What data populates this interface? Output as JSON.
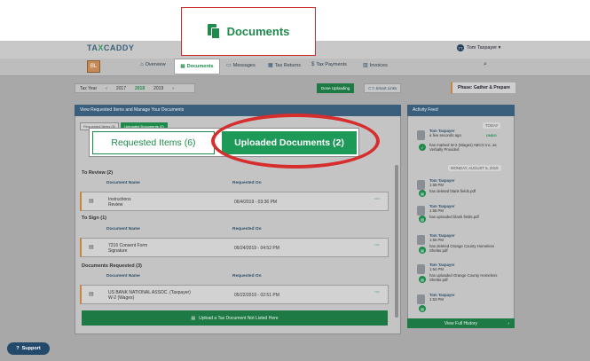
{
  "app": {
    "logo_main": "TA",
    "logo_accent": "X",
    "logo_rest": "CADDY",
    "user_initials": "TT",
    "user_name": "Tom Taxpayer ▾",
    "brand_initials": "BL"
  },
  "nav": {
    "overview": "Overview",
    "documents": "Documents",
    "messages": "Messages",
    "tax_returns": "Tax Returns",
    "tax_payments": "Tax Payments",
    "invoices": "Invoices"
  },
  "callout": {
    "documents": "Documents"
  },
  "tax_year": {
    "label": "Tax Year",
    "years": [
      "2017",
      "2018",
      "2019"
    ],
    "selected": "2018"
  },
  "actions": {
    "done_uploading": "Done Uploading",
    "smart_links": "Smart Links",
    "phase": "Phase: Gather & Prepare"
  },
  "panel": {
    "title": "View Requested Items and Manage Your Documents",
    "small_tabs": [
      "Requested Items (6)",
      "Uploaded Documents (2)"
    ],
    "tabs": {
      "requested": "Requested Items (6)",
      "uploaded": "Uploaded Documents (2)"
    },
    "col_name": "Document Name",
    "col_requested": "Requested On",
    "sections": [
      {
        "title": "To Review (2)",
        "rows": [
          {
            "name": "Instructions",
            "sub": "Review",
            "date": "06/4/2019 - 03:36 PM"
          }
        ]
      },
      {
        "title": "To Sign (1)",
        "rows": [
          {
            "name": "7216 Consent Form",
            "sub": "Signature",
            "date": "06/24/2019 - 04:52 PM"
          }
        ]
      },
      {
        "title": "Documents Requested (3)",
        "rows": [
          {
            "name": "US BANK NATIONAL ASSOC. (Taxpayer)",
            "sub": "W-2 (Wages)",
            "date": "05/22/2019 - 02:51 PM"
          }
        ]
      }
    ],
    "upload_label": "Upload a Tax Document Not Listed Here",
    "dots": "···"
  },
  "feed": {
    "title": "Activity Feed",
    "today": "TODAY",
    "monday": "MONDAY, AUGUST 5, 2019",
    "undo": "UNDO",
    "items": [
      {
        "who": "Tom Taxpayer",
        "when": "a few seconds ago",
        "text": "has marked W-2 (Wages) ABCO Inc. as Verbally Provided"
      },
      {
        "who": "Tom Taxpayer",
        "when": "1:59 PM",
        "text": "has deleted blank fields.pdf"
      },
      {
        "who": "Tom Taxpayer",
        "when": "1:58 PM",
        "text": "has uploaded blank fields.pdf"
      },
      {
        "who": "Tom Taxpayer",
        "when": "1:55 PM",
        "text": "has deleted Orange County Homeless Shelter.pdf"
      },
      {
        "who": "Tom Taxpayer",
        "when": "1:54 PM",
        "text": "has uploaded Orange County Homeless Shelter.pdf"
      },
      {
        "who": "Tom Taxpayer",
        "when": "1:53 PM",
        "text": ""
      }
    ],
    "footer": "View Full History",
    "footer_chev": "›"
  },
  "support": {
    "label": "Support"
  }
}
